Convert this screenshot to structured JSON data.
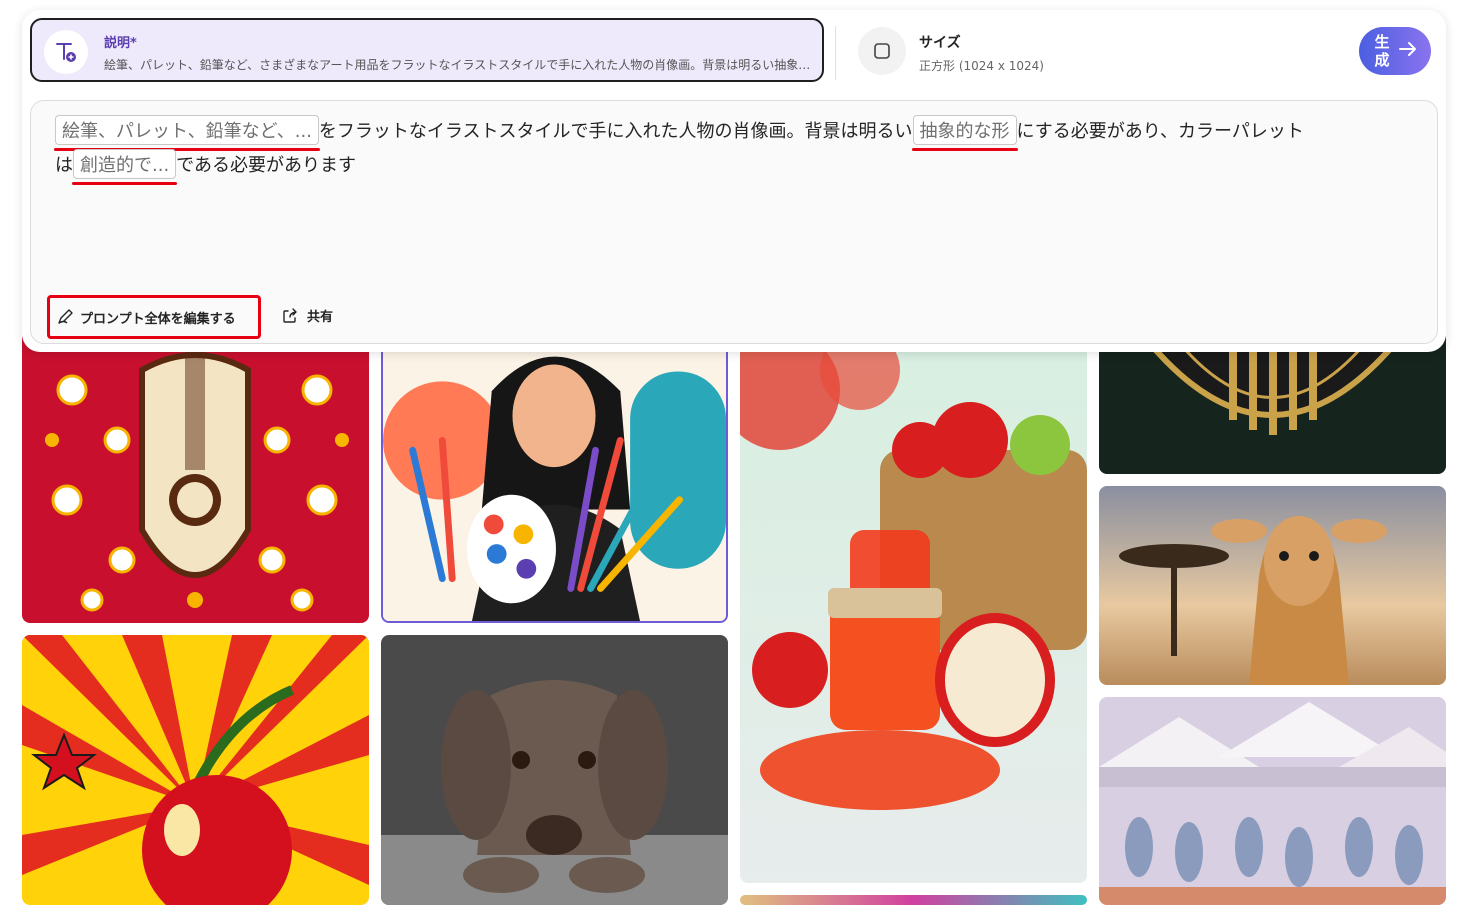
{
  "description": {
    "title": "説明*",
    "text": "絵筆、パレット、鉛筆など、さまざまなアート用品をフラットなイラストスタイルで手に入れた人物の肖像画。背景は明るい抽象的な形にする必要があり、カラーパレットは創造的で..."
  },
  "size": {
    "title": "サイズ",
    "value": "正方形 (1024 x 1024)"
  },
  "generate": {
    "label": "生成"
  },
  "prompt": {
    "chip1": "絵筆、パレット、鉛筆など、...",
    "text1": "をフラットなイラストスタイルで手に入れた人物の肖像画。背景は明るい",
    "chip2": "抽象的な形",
    "text2": "にする必要があり、カラーパレット",
    "text3": "は",
    "chip3": "創造的で...",
    "text4": "である必要があります"
  },
  "actions": {
    "edit_all": "プロンプト全体を編集する",
    "share": "共有"
  },
  "gallery": [
    {
      "name": "folk-guitar-image"
    },
    {
      "name": "artist-woman-image"
    },
    {
      "name": "apple-jam-image"
    },
    {
      "name": "art-deco-image"
    },
    {
      "name": "giraffe-image"
    },
    {
      "name": "cherry-popart-image"
    },
    {
      "name": "dog-image"
    },
    {
      "name": "market-tents-image"
    }
  ]
}
